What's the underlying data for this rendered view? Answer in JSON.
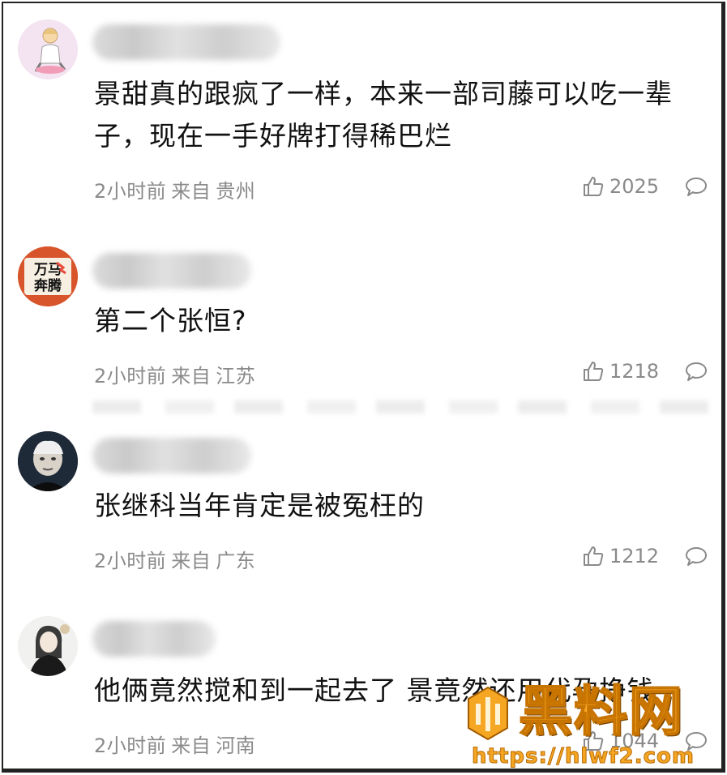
{
  "comments": [
    {
      "text": "景甜真的跟疯了一样，本来一部司藤可以吃一辈子，现在一手好牌打得稀巴烂",
      "time": "2小时前",
      "from": "来自",
      "location": "贵州",
      "likes": "2025",
      "avatar_icon": "avatar-anime-girl"
    },
    {
      "text": "第二个张恒?",
      "time": "2小时前",
      "from": "来自",
      "location": "江苏",
      "likes": "1218",
      "avatar_icon": "avatar-horse-logo",
      "avatar_text": "万马奔腾"
    },
    {
      "text": "张继科当年肯定是被冤枉的",
      "time": "2小时前",
      "from": "来自",
      "location": "广东",
      "likes": "1212",
      "avatar_icon": "avatar-old-man"
    },
    {
      "text": "他俩竟然搅和到一起去了 景竟然还用代孕挣钱",
      "time": "2小时前",
      "from": "来自",
      "location": "河南",
      "likes": "1044",
      "avatar_icon": "avatar-girl-sketch"
    }
  ],
  "watermark": {
    "title": "黑料网",
    "url": "https://hlwf2.com"
  },
  "colors": {
    "text": "#111111",
    "meta": "#8a8a8a",
    "watermark": "#f5a623"
  }
}
